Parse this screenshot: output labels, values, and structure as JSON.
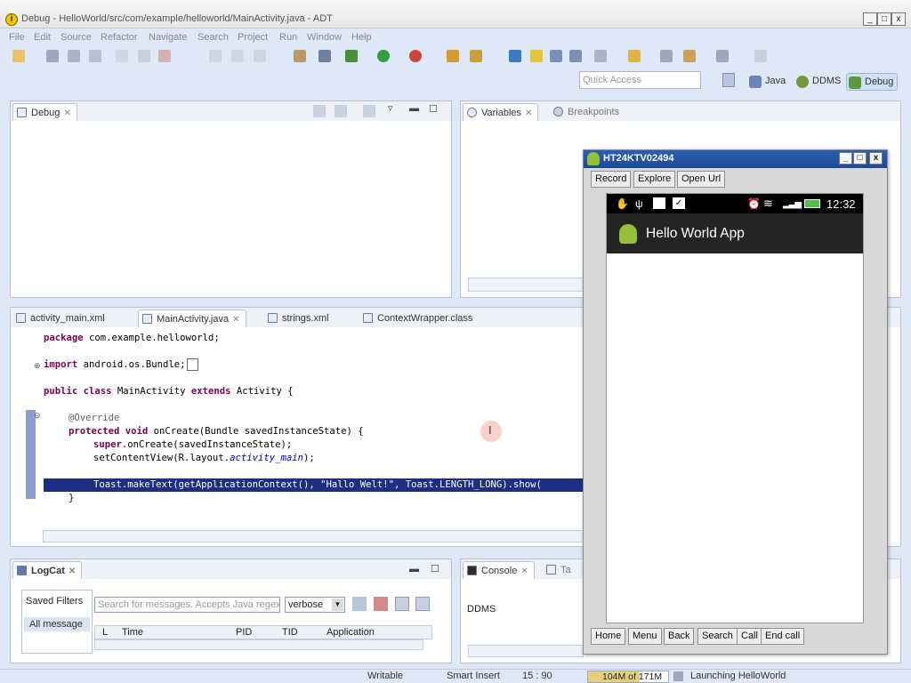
{
  "window": {
    "title": "Debug - HelloWorld/src/com/example/helloworld/MainActivity.java - ADT",
    "title_icon": "i",
    "minimize": "_",
    "maximize": "□",
    "close": "x"
  },
  "menu": [
    "File",
    "Edit",
    "Source",
    "Refactor",
    "Navigate",
    "Search",
    "Project",
    "Run",
    "Window",
    "Help"
  ],
  "toolbar": {
    "quick_access_placeholder": "Quick Access",
    "perspectives": [
      "Java",
      "DDMS",
      "Debug"
    ]
  },
  "debug_view": {
    "tab": "Debug",
    "close": "✕"
  },
  "variables_view": {
    "tabs": [
      "Variables",
      "Breakpoints"
    ],
    "close": "✕"
  },
  "editor": {
    "tabs": [
      "activity_main.xml",
      "MainActivity.java",
      "strings.xml",
      "ContextWrapper.class"
    ],
    "active_tab": "MainActivity.java",
    "lines": {
      "l1_kw": "package",
      "l1_rest": " com.example.helloworld;",
      "l2_kw": "import",
      "l2_rest": " android.os.Bundle;",
      "l3_kw1": "public class",
      "l3_name": " MainActivity ",
      "l3_kw2": "extends",
      "l3_rest": " Activity {",
      "l4": "@Override",
      "l5_kw": "protected void",
      "l5_rest": " onCreate(Bundle savedInstanceState) {",
      "l6_kw": "super",
      "l6_rest": ".onCreate(savedInstanceState);",
      "l7_a": "setContentView(R.layout.",
      "l7_b": "activity_main",
      "l7_c": ");",
      "l8": "Toast.makeText(getApplicationContext(), \"Hallo Welt!\", Toast.LENGTH_LONG).show(",
      "l9": "}"
    }
  },
  "logcat": {
    "tab": "LogCat",
    "saved_filters": "Saved Filters",
    "all_messages": "All message",
    "search_placeholder": "Search for messages. Accepts Java regexes",
    "level": "verbose",
    "columns": [
      "L",
      "Time",
      "PID",
      "TID",
      "Application"
    ]
  },
  "console": {
    "tabs": [
      "Console",
      "Ta"
    ],
    "content": "DDMS"
  },
  "emulator": {
    "title": "HT24KTV02494",
    "buttons_top": [
      "Record",
      "Explore",
      "Open Url"
    ],
    "time": "12:32",
    "app_title": "Hello World App",
    "buttons_bottom": [
      "Home",
      "Menu",
      "Back",
      "Search",
      "Call",
      "End call"
    ]
  },
  "statusbar": {
    "writable": "Writable",
    "insert_mode": "Smart Insert",
    "position": "15 : 90",
    "heap": "104M of 171M",
    "progress": "Launching HelloWorld"
  }
}
